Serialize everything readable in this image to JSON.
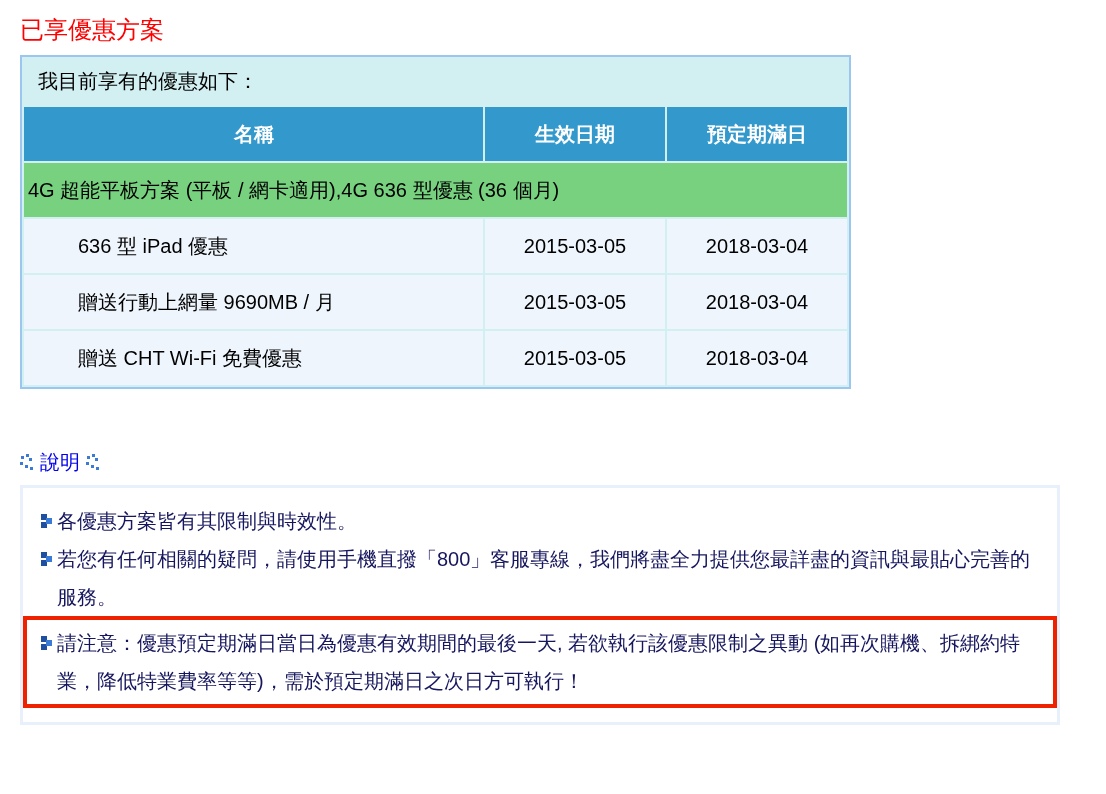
{
  "title": "已享優惠方案",
  "table": {
    "caption": "我目前享有的優惠如下：",
    "columns": [
      "名稱",
      "生效日期",
      "預定期滿日"
    ],
    "groups": [
      {
        "title": "4G 超能平板方案 (平板 / 網卡適用),4G 636 型優惠 (36 個月)",
        "rows": [
          {
            "name": "636 型 iPad 優惠",
            "start": "2015-03-05",
            "end": "2018-03-04"
          },
          {
            "name": "贈送行動上網量 9690MB / 月",
            "start": "2015-03-05",
            "end": "2018-03-04"
          },
          {
            "name": "贈送 CHT Wi-Fi 免費優惠",
            "start": "2015-03-05",
            "end": "2018-03-04"
          }
        ]
      }
    ]
  },
  "notes": {
    "heading": "說明",
    "items": [
      {
        "text": "各優惠方案皆有其限制與時效性。",
        "highlighted": false
      },
      {
        "text": "若您有任何相關的疑問，請使用手機直撥「800」客服專線，我們將盡全力提供您最詳盡的資訊與最貼心完善的服務。",
        "highlighted": false
      },
      {
        "text": "請注意：優惠預定期滿日當日為優惠有效期間的最後一天, 若欲執行該優惠限制之異動 (如再次購機、拆綁約特業，降低特業費率等等)，需於預定期滿日之次日方可執行！",
        "highlighted": true
      }
    ]
  }
}
